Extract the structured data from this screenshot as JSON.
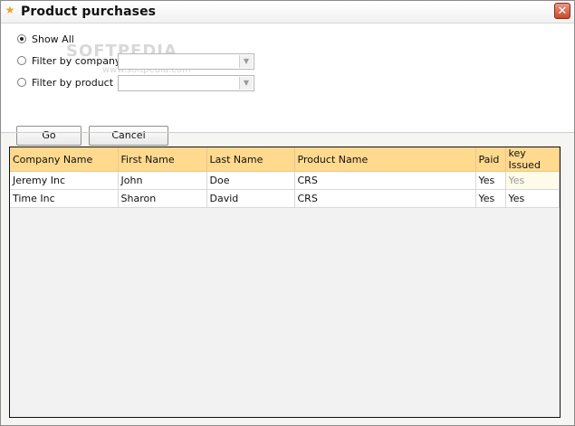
{
  "window": {
    "title": "Product purchases"
  },
  "watermark": {
    "text": "SOFTPEDIA",
    "small": "www.softpedia.com"
  },
  "filters": {
    "show_all": "Show All",
    "by_company": "Filter by company",
    "by_product": "Filter by product",
    "company_value": "",
    "product_value": "",
    "selected": "show_all"
  },
  "buttons": {
    "go": "Go",
    "cancel": "Cancel"
  },
  "table": {
    "columns": [
      "Company Name",
      "First Name",
      "Last Name",
      "Product Name",
      "Paid",
      "key Issued"
    ],
    "rows": [
      [
        "Jeremy Inc",
        "John",
        "Doe",
        "CRS",
        "Yes",
        "Yes"
      ],
      [
        "Time Inc",
        "Sharon",
        "David",
        "CRS",
        "Yes",
        "Yes"
      ]
    ]
  },
  "colors": {
    "header": "#ffd98e",
    "close_button": "#c94a2b"
  },
  "icons": {
    "title": "star-icon",
    "close": "close-icon"
  }
}
